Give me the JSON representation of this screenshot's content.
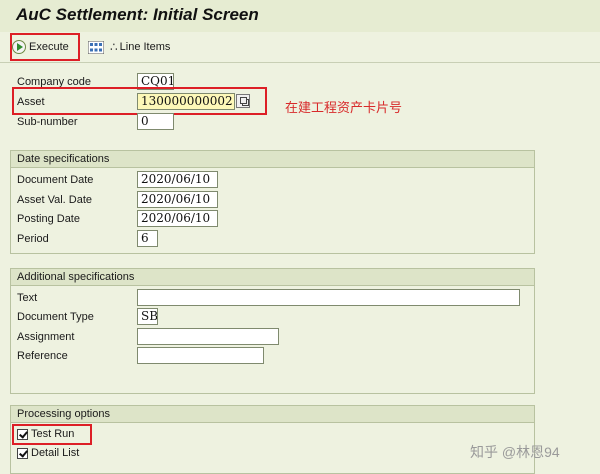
{
  "window": {
    "title": "AuC Settlement: Initial Screen"
  },
  "toolbar": {
    "execute_label": "Execute",
    "line_items_label": "Line Items"
  },
  "header_fields": {
    "company_code": {
      "label": "Company code",
      "value": "CQ01"
    },
    "asset": {
      "label": "Asset",
      "value": "130000000002"
    },
    "sub_number": {
      "label": "Sub-number",
      "value": "0"
    }
  },
  "annotation": {
    "text": "在建工程资产卡片号"
  },
  "date_specifications": {
    "title": "Date specifications",
    "document_date": {
      "label": "Document Date",
      "value": "2020/06/10"
    },
    "asset_val_date": {
      "label": "Asset Val. Date",
      "value": "2020/06/10"
    },
    "posting_date": {
      "label": "Posting Date",
      "value": "2020/06/10"
    },
    "period": {
      "label": "Period",
      "value": "6"
    }
  },
  "additional_specifications": {
    "title": "Additional specifications",
    "text": {
      "label": "Text",
      "value": ""
    },
    "document_type": {
      "label": "Document Type",
      "value": "SB"
    },
    "assignment": {
      "label": "Assignment",
      "value": ""
    },
    "reference": {
      "label": "Reference",
      "value": ""
    }
  },
  "processing_options": {
    "title": "Processing options",
    "test_run": {
      "label": "Test Run",
      "checked": true
    },
    "detail_list": {
      "label": "Detail List",
      "checked": true
    }
  },
  "watermark": {
    "text": "知乎 @林恩94"
  },
  "colors": {
    "highlight_box": "#dd1f26",
    "annotation": "#d82a2a",
    "background": "#eef2e0"
  }
}
